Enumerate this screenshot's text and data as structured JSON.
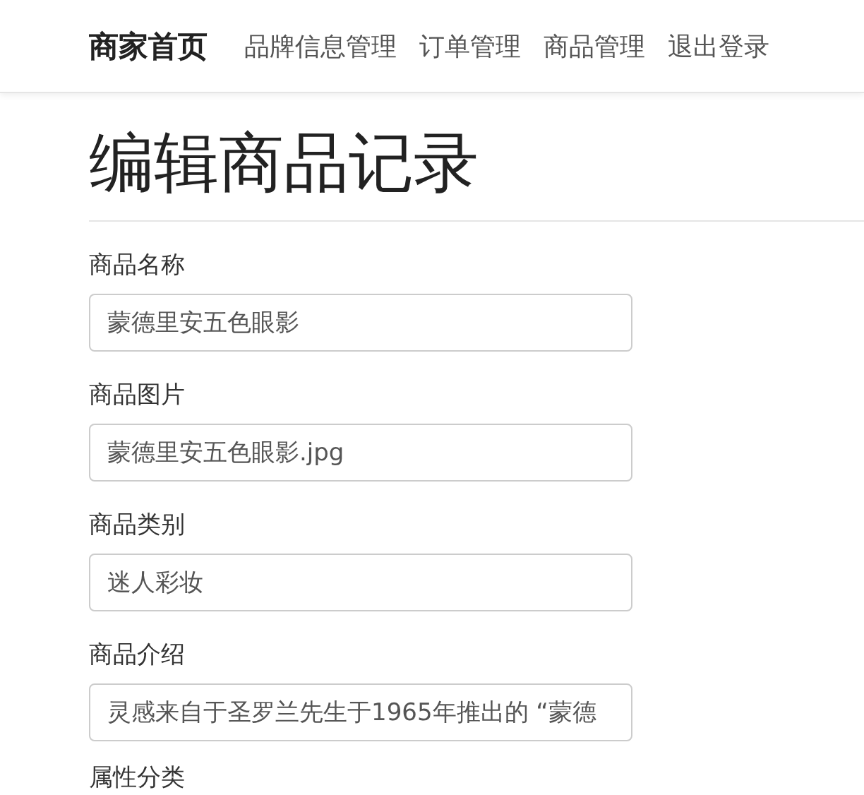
{
  "navbar": {
    "brand": "商家首页",
    "links": [
      "品牌信息管理",
      "订单管理",
      "商品管理",
      "退出登录"
    ]
  },
  "title": "编辑商品记录",
  "fields": [
    {
      "label": "商品名称",
      "value": "蒙德里安五色眼影"
    },
    {
      "label": "商品图片",
      "value": "蒙德里安五色眼影.jpg"
    },
    {
      "label": "商品类别",
      "value": "迷人彩妆"
    },
    {
      "label": "商品介绍",
      "value": "灵感来自于圣罗兰先生于1965年推出的 “蒙德"
    }
  ],
  "next_label": "属性分类"
}
